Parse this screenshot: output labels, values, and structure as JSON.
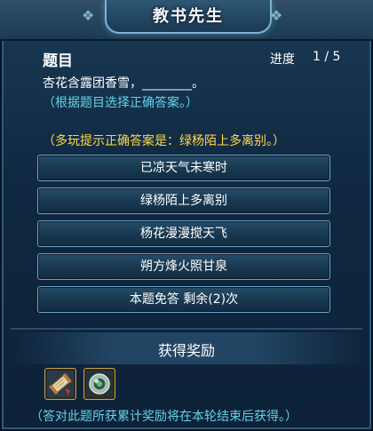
{
  "window": {
    "title": "教书先生"
  },
  "header": {
    "section_title": "题目",
    "progress_label": "进度",
    "progress_value": "1 / 5"
  },
  "question": {
    "text": "杏花含露团香雪，________。",
    "hint": "（根据题目选择正确答案。）"
  },
  "multi_hint": "（多玩提示正确答案是：绿杨陌上多离别。）",
  "options": [
    {
      "label": "已凉天气未寒时"
    },
    {
      "label": "绿杨陌上多离别"
    },
    {
      "label": "杨花漫漫搅天飞"
    },
    {
      "label": "朔方烽火照甘泉"
    },
    {
      "label": "本题免答 剩余(2)次"
    }
  ],
  "reward": {
    "title": "获得奖励",
    "items": [
      {
        "icon": "scroll-icon"
      },
      {
        "icon": "jade-orb-icon"
      }
    ],
    "footer": "（答对此题所获累计奖励将在本轮结束后获得。）"
  },
  "colors": {
    "hint_cyan": "#62d3e8",
    "multi_hint_yellow": "#ffd84a",
    "button_border": "#6fa3c6",
    "slot_border": "#c9a04a"
  }
}
